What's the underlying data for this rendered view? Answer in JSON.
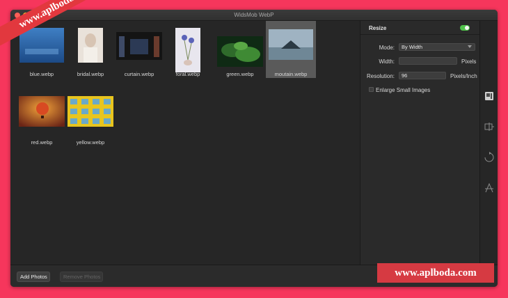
{
  "window": {
    "title": "WidsMob WebP"
  },
  "gallery": {
    "items": [
      {
        "name": "blue.webp",
        "selected": false
      },
      {
        "name": "bridal.webp",
        "selected": false
      },
      {
        "name": "curtain.webp",
        "selected": false
      },
      {
        "name": "foral.webp",
        "selected": false
      },
      {
        "name": "green.webp",
        "selected": false
      },
      {
        "name": "moutain.webp",
        "selected": true
      },
      {
        "name": "red.webp",
        "selected": false
      },
      {
        "name": "yellow.webp",
        "selected": false
      }
    ]
  },
  "settings": {
    "section_title": "Resize",
    "resize_enabled": true,
    "mode_label": "Mode:",
    "mode_value": "By Width",
    "width_label": "Width:",
    "width_value": "",
    "width_unit": "Pixels",
    "resolution_label": "Resolution:",
    "resolution_value": "96",
    "resolution_unit": "Pixels/Inch",
    "enlarge_label": "Enlarge Small Images",
    "enlarge_checked": false
  },
  "tools": [
    "resize-icon",
    "watermark-icon",
    "rotate-icon",
    "text-icon"
  ],
  "footer": {
    "add_label": "Add Photos",
    "remove_label": "Remove Photos"
  },
  "watermarks": {
    "diagonal": "www.aplboda.com",
    "corner": "www.aplboda.com"
  },
  "colors": {
    "background": "#f6365c",
    "toggle_on": "#4fc24a",
    "watermark_red": "#d63a42"
  }
}
